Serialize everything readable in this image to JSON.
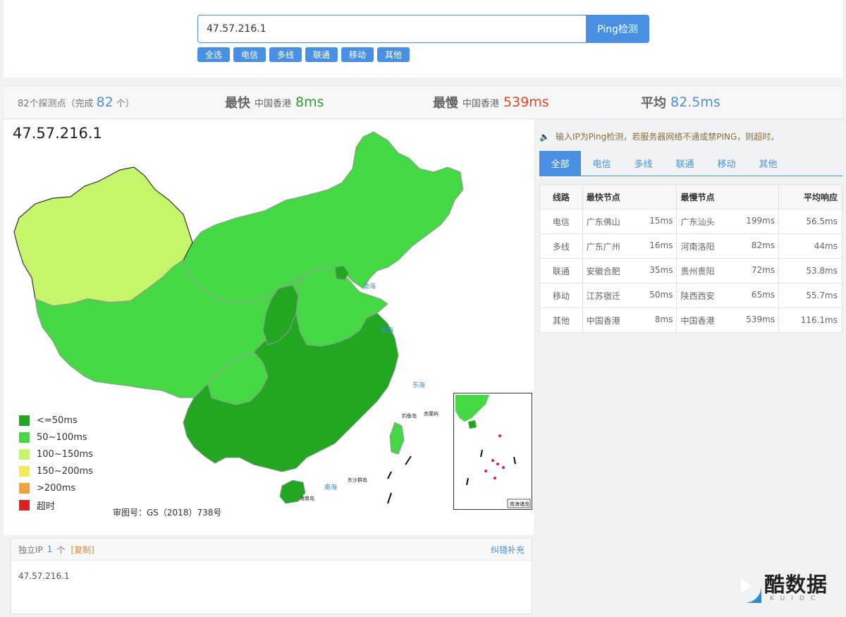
{
  "search": {
    "value": "47.57.216.1",
    "button": "Ping检测"
  },
  "filters": [
    "全选",
    "电信",
    "多线",
    "联通",
    "移动",
    "其他"
  ],
  "stats": {
    "points_prefix": "82个探测点（完成",
    "points_done": "82",
    "points_suffix": "个）",
    "fastest_label": "最快",
    "fastest_loc": "中国香港",
    "fastest_val": "8ms",
    "slowest_label": "最慢",
    "slowest_loc": "中国香港",
    "slowest_val": "539ms",
    "avg_label": "平均",
    "avg_val": "82.5ms"
  },
  "colors": {
    "fastest": "#2e9e30",
    "slowest": "#e4452b",
    "avg": "#4a90e2"
  },
  "map": {
    "ip": "47.57.216.1",
    "review_no": "审图号：GS（2018）738号",
    "legend": [
      {
        "label": "<=50ms",
        "color": "#22a722"
      },
      {
        "label": "50~100ms",
        "color": "#45d845"
      },
      {
        "label": "100~150ms",
        "color": "#c4f56a"
      },
      {
        "label": "150~200ms",
        "color": "#f5e85a"
      },
      {
        "label": ">200ms",
        "color": "#f5a03a"
      },
      {
        "label": "超时",
        "color": "#dd2020"
      }
    ],
    "labels": {
      "bohai": "渤海",
      "huanghai": "黄海",
      "donghai": "东海",
      "nanhai": "南海",
      "hainan": "海南岛",
      "diaoyu": "钓鱼岛",
      "chiwei": "赤尾屿",
      "dongsha": "东沙群岛",
      "inset_title": "南海诸岛"
    }
  },
  "ip_panel": {
    "label": "独立IP",
    "count": "1",
    "unit": "个",
    "copy": "[复制]",
    "fix": "纠错补充",
    "ips": [
      "47.57.216.1"
    ]
  },
  "notice": "输入IP为Ping检测，若服务器网络不通或禁PING，则超时。",
  "tabs": [
    "全部",
    "电信",
    "多线",
    "联通",
    "移动",
    "其他"
  ],
  "table": {
    "headers": [
      "线路",
      "最快节点",
      "最慢节点",
      "平均响应"
    ],
    "rows": [
      {
        "line": "电信",
        "fast_node": "广东佛山",
        "fast_ms": "15ms",
        "slow_node": "广东汕头",
        "slow_ms": "199ms",
        "avg": "56.5ms"
      },
      {
        "line": "多线",
        "fast_node": "广东广州",
        "fast_ms": "16ms",
        "slow_node": "河南洛阳",
        "slow_ms": "82ms",
        "avg": "44ms"
      },
      {
        "line": "联通",
        "fast_node": "安徽合肥",
        "fast_ms": "35ms",
        "slow_node": "贵州贵阳",
        "slow_ms": "72ms",
        "avg": "53.8ms"
      },
      {
        "line": "移动",
        "fast_node": "江苏宿迁",
        "fast_ms": "50ms",
        "slow_node": "陕西西安",
        "slow_ms": "65ms",
        "avg": "55.7ms"
      },
      {
        "line": "其他",
        "fast_node": "中国香港",
        "fast_ms": "8ms",
        "slow_node": "中国香港",
        "slow_ms": "539ms",
        "avg": "116.1ms"
      }
    ]
  },
  "watermark": {
    "text": "酷数据",
    "sub": "KUIDC"
  }
}
